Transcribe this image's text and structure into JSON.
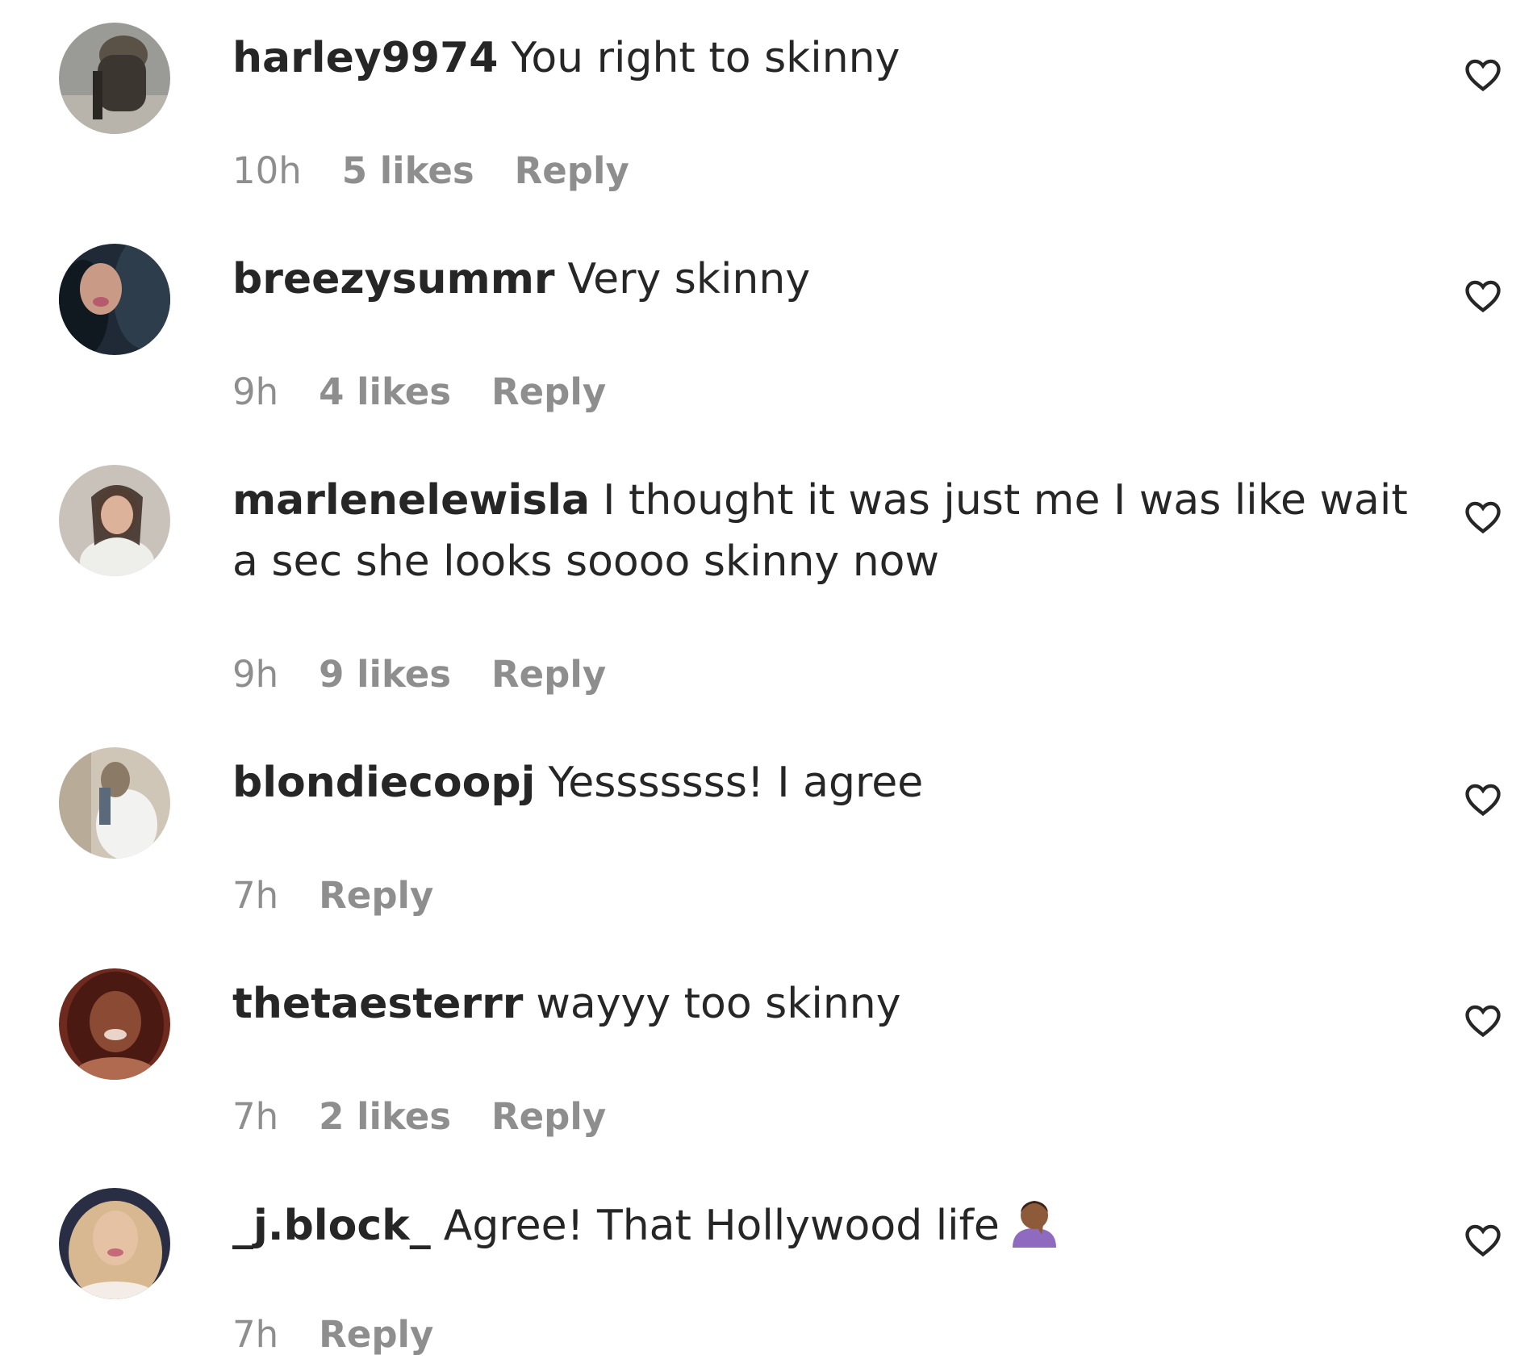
{
  "colors": {
    "text_primary": "#262626",
    "text_secondary": "#8e8e8e",
    "background": "#ffffff"
  },
  "comments": [
    {
      "username": "harley9974",
      "text": "You right to skinny",
      "time": "10h",
      "likes": "5 likes",
      "reply": "Reply",
      "icon": "heart-outline-icon"
    },
    {
      "username": "breezysummr",
      "text": "Very skinny",
      "time": "9h",
      "likes": "4 likes",
      "reply": "Reply",
      "icon": "heart-outline-icon"
    },
    {
      "username": "marlenelewisla",
      "text": "I thought it was just me I was like wait a sec she looks soooo skinny now",
      "time": "9h",
      "likes": "9 likes",
      "reply": "Reply",
      "icon": "heart-outline-icon"
    },
    {
      "username": "blondiecoopj",
      "text": "Yesssssss! I agree",
      "time": "7h",
      "reply": "Reply",
      "icon": "heart-outline-icon"
    },
    {
      "username": "thetaesterrr",
      "text": "wayyy too skinny",
      "time": "7h",
      "likes": "2 likes",
      "reply": "Reply",
      "icon": "heart-outline-icon"
    },
    {
      "username": "_j.block_",
      "text": "Agree! That Hollywood life",
      "emoji": "facepalm-emoji-icon",
      "time": "7h",
      "reply": "Reply",
      "icon": "heart-outline-icon"
    }
  ]
}
